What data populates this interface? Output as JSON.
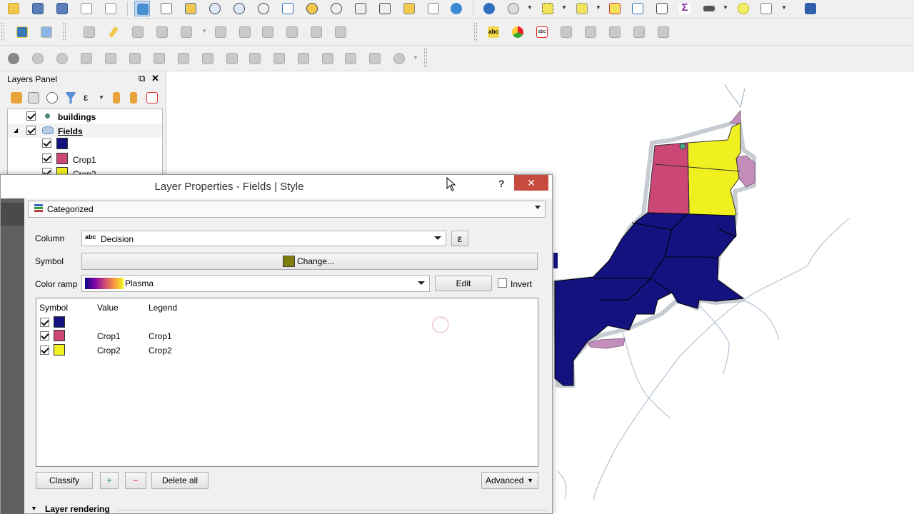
{
  "layers_panel": {
    "title": "Layers Panel",
    "layers": [
      {
        "name": "buildings",
        "checked": true
      },
      {
        "name": "Fields",
        "checked": true,
        "classes": [
          {
            "label": "",
            "color": "#13127f",
            "checked": true
          },
          {
            "label": "Crop1",
            "color": "#cc4676",
            "checked": true
          },
          {
            "label": "Crop2",
            "color": "#f0f021",
            "checked": true
          }
        ]
      }
    ]
  },
  "dialog": {
    "title": "Layer Properties - Fields | Style",
    "help": "?",
    "close": "✕",
    "renderer": "Categorized",
    "column_label": "Column",
    "column_type": "abc",
    "column_value": "Decision",
    "expression_btn": "ε",
    "symbol_label": "Symbol",
    "symbol_change": "Change...",
    "symbol_color": "#7d7d10",
    "color_ramp_label": "Color ramp",
    "color_ramp_value": "Plasma",
    "edit_btn": "Edit",
    "invert_label": "Invert",
    "table": {
      "headers": [
        "Symbol",
        "Value",
        "Legend"
      ],
      "rows": [
        {
          "color": "#13127f",
          "value": "",
          "legend": "",
          "checked": true
        },
        {
          "color": "#cc4676",
          "value": "Crop1",
          "legend": "Crop1",
          "checked": true
        },
        {
          "color": "#f0f021",
          "value": "Crop2",
          "legend": "Crop2",
          "checked": true
        }
      ]
    },
    "classify_btn": "Classify",
    "add_btn": "+",
    "remove_btn": "−",
    "delete_all_btn": "Delete all",
    "advanced_btn": "Advanced",
    "layer_rendering": "Layer rendering"
  },
  "colors": {
    "navy": "#13127f",
    "crop1": "#cc4676",
    "crop2": "#f0f021",
    "purple": "#c48ebc",
    "close_red": "#c74a3f"
  }
}
